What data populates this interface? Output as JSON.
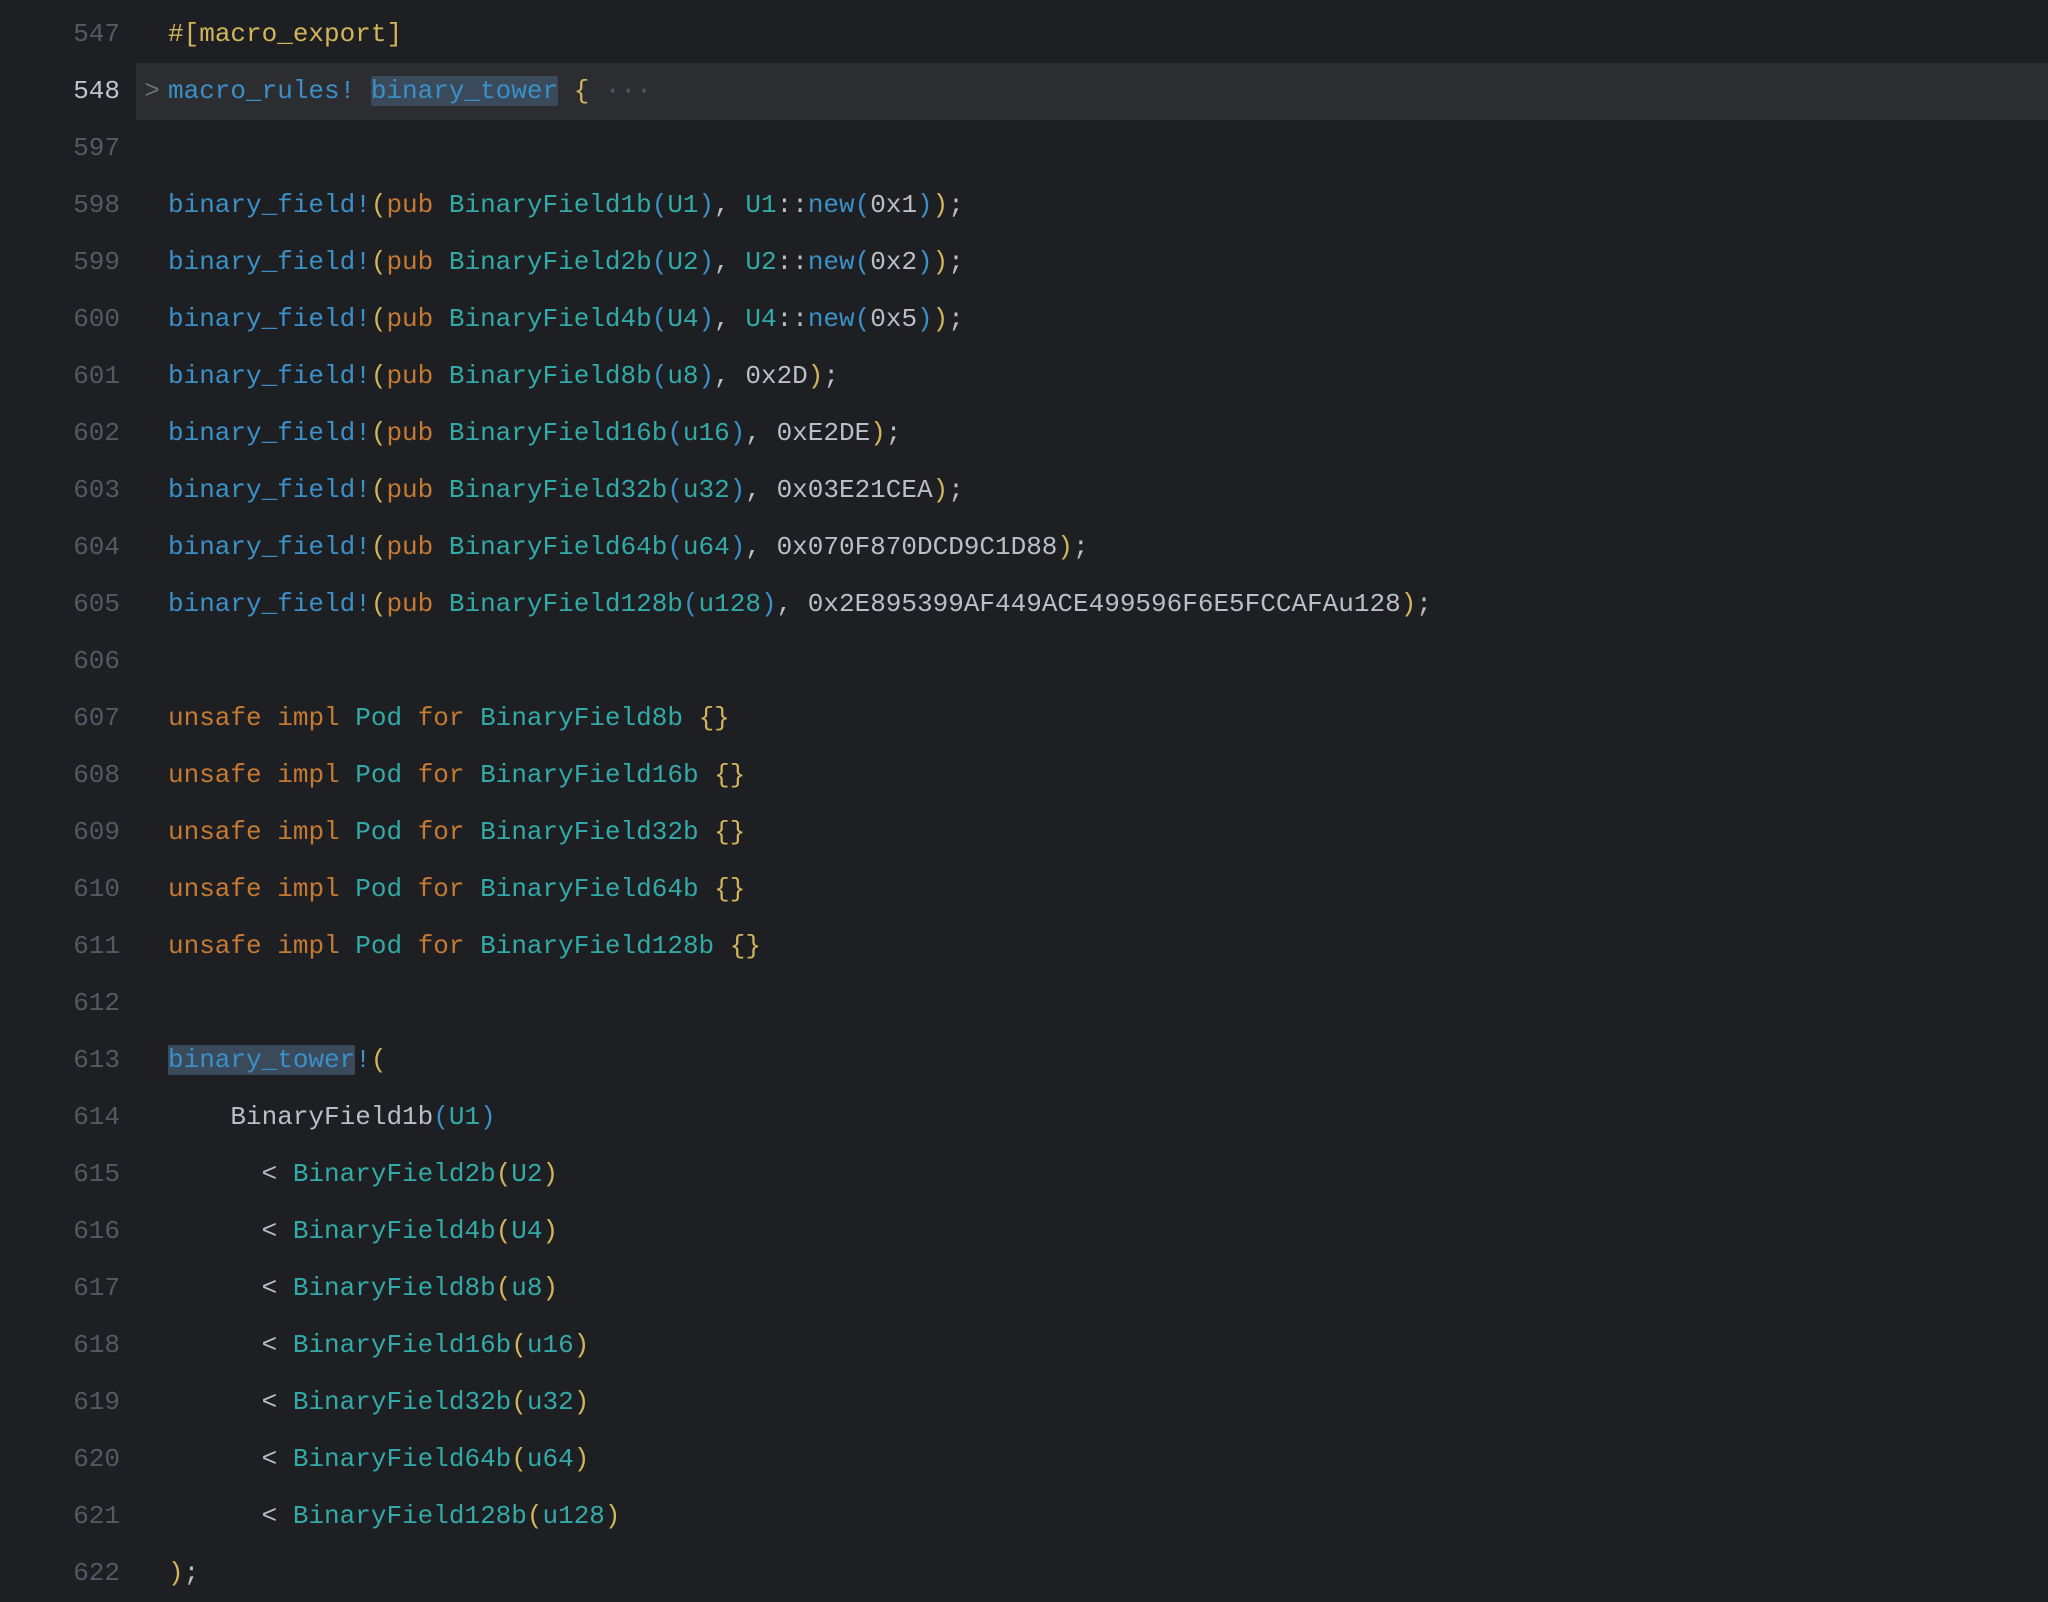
{
  "lines": [
    {
      "num": "547",
      "fold": " ",
      "current": false,
      "tokens": [
        {
          "t": "#[",
          "c": "c-attr"
        },
        {
          "t": "macro_export",
          "c": "c-attr"
        },
        {
          "t": "]",
          "c": "c-attr"
        }
      ]
    },
    {
      "num": "548",
      "fold": ">",
      "current": true,
      "tokens": [
        {
          "t": "macro_rules!",
          "c": "c-macrodef"
        },
        {
          "t": " ",
          "c": "c-plain"
        },
        {
          "t": "binary_tower",
          "c": "c-macrodef",
          "sel": true
        },
        {
          "t": " ",
          "c": "c-plain"
        },
        {
          "t": "{",
          "c": "c-brace"
        },
        {
          "t": " ···",
          "c": "c-faint"
        }
      ]
    },
    {
      "num": "597",
      "fold": " ",
      "current": false,
      "tokens": []
    },
    {
      "num": "598",
      "fold": " ",
      "current": false,
      "tokens": [
        {
          "t": "binary_field!",
          "c": "c-macro"
        },
        {
          "t": "(",
          "c": "c-paren1"
        },
        {
          "t": "pub",
          "c": "c-kw"
        },
        {
          "t": " ",
          "c": "c-plain"
        },
        {
          "t": "BinaryField1b",
          "c": "c-type"
        },
        {
          "t": "(",
          "c": "c-paren2"
        },
        {
          "t": "U1",
          "c": "c-type"
        },
        {
          "t": ")",
          "c": "c-paren2"
        },
        {
          "t": ", ",
          "c": "c-punct"
        },
        {
          "t": "U1",
          "c": "c-type"
        },
        {
          "t": "::",
          "c": "c-punct"
        },
        {
          "t": "new",
          "c": "c-fn"
        },
        {
          "t": "(",
          "c": "c-paren2"
        },
        {
          "t": "0x1",
          "c": "c-num"
        },
        {
          "t": ")",
          "c": "c-paren2"
        },
        {
          "t": ")",
          "c": "c-paren1"
        },
        {
          "t": ";",
          "c": "c-punct"
        }
      ]
    },
    {
      "num": "599",
      "fold": " ",
      "current": false,
      "tokens": [
        {
          "t": "binary_field!",
          "c": "c-macro"
        },
        {
          "t": "(",
          "c": "c-paren1"
        },
        {
          "t": "pub",
          "c": "c-kw"
        },
        {
          "t": " ",
          "c": "c-plain"
        },
        {
          "t": "BinaryField2b",
          "c": "c-type"
        },
        {
          "t": "(",
          "c": "c-paren2"
        },
        {
          "t": "U2",
          "c": "c-type"
        },
        {
          "t": ")",
          "c": "c-paren2"
        },
        {
          "t": ", ",
          "c": "c-punct"
        },
        {
          "t": "U2",
          "c": "c-type"
        },
        {
          "t": "::",
          "c": "c-punct"
        },
        {
          "t": "new",
          "c": "c-fn"
        },
        {
          "t": "(",
          "c": "c-paren2"
        },
        {
          "t": "0x2",
          "c": "c-num"
        },
        {
          "t": ")",
          "c": "c-paren2"
        },
        {
          "t": ")",
          "c": "c-paren1"
        },
        {
          "t": ";",
          "c": "c-punct"
        }
      ]
    },
    {
      "num": "600",
      "fold": " ",
      "current": false,
      "tokens": [
        {
          "t": "binary_field!",
          "c": "c-macro"
        },
        {
          "t": "(",
          "c": "c-paren1"
        },
        {
          "t": "pub",
          "c": "c-kw"
        },
        {
          "t": " ",
          "c": "c-plain"
        },
        {
          "t": "BinaryField4b",
          "c": "c-type"
        },
        {
          "t": "(",
          "c": "c-paren2"
        },
        {
          "t": "U4",
          "c": "c-type"
        },
        {
          "t": ")",
          "c": "c-paren2"
        },
        {
          "t": ", ",
          "c": "c-punct"
        },
        {
          "t": "U4",
          "c": "c-type"
        },
        {
          "t": "::",
          "c": "c-punct"
        },
        {
          "t": "new",
          "c": "c-fn"
        },
        {
          "t": "(",
          "c": "c-paren2"
        },
        {
          "t": "0x5",
          "c": "c-num"
        },
        {
          "t": ")",
          "c": "c-paren2"
        },
        {
          "t": ")",
          "c": "c-paren1"
        },
        {
          "t": ";",
          "c": "c-punct"
        }
      ]
    },
    {
      "num": "601",
      "fold": " ",
      "current": false,
      "tokens": [
        {
          "t": "binary_field!",
          "c": "c-macro"
        },
        {
          "t": "(",
          "c": "c-paren1"
        },
        {
          "t": "pub",
          "c": "c-kw"
        },
        {
          "t": " ",
          "c": "c-plain"
        },
        {
          "t": "BinaryField8b",
          "c": "c-type"
        },
        {
          "t": "(",
          "c": "c-paren2"
        },
        {
          "t": "u8",
          "c": "c-type"
        },
        {
          "t": ")",
          "c": "c-paren2"
        },
        {
          "t": ", ",
          "c": "c-punct"
        },
        {
          "t": "0x2D",
          "c": "c-num"
        },
        {
          "t": ")",
          "c": "c-paren1"
        },
        {
          "t": ";",
          "c": "c-punct"
        }
      ]
    },
    {
      "num": "602",
      "fold": " ",
      "current": false,
      "tokens": [
        {
          "t": "binary_field!",
          "c": "c-macro"
        },
        {
          "t": "(",
          "c": "c-paren1"
        },
        {
          "t": "pub",
          "c": "c-kw"
        },
        {
          "t": " ",
          "c": "c-plain"
        },
        {
          "t": "BinaryField16b",
          "c": "c-type"
        },
        {
          "t": "(",
          "c": "c-paren2"
        },
        {
          "t": "u16",
          "c": "c-type"
        },
        {
          "t": ")",
          "c": "c-paren2"
        },
        {
          "t": ", ",
          "c": "c-punct"
        },
        {
          "t": "0xE2DE",
          "c": "c-num"
        },
        {
          "t": ")",
          "c": "c-paren1"
        },
        {
          "t": ";",
          "c": "c-punct"
        }
      ]
    },
    {
      "num": "603",
      "fold": " ",
      "current": false,
      "tokens": [
        {
          "t": "binary_field!",
          "c": "c-macro"
        },
        {
          "t": "(",
          "c": "c-paren1"
        },
        {
          "t": "pub",
          "c": "c-kw"
        },
        {
          "t": " ",
          "c": "c-plain"
        },
        {
          "t": "BinaryField32b",
          "c": "c-type"
        },
        {
          "t": "(",
          "c": "c-paren2"
        },
        {
          "t": "u32",
          "c": "c-type"
        },
        {
          "t": ")",
          "c": "c-paren2"
        },
        {
          "t": ", ",
          "c": "c-punct"
        },
        {
          "t": "0x03E21CEA",
          "c": "c-num"
        },
        {
          "t": ")",
          "c": "c-paren1"
        },
        {
          "t": ";",
          "c": "c-punct"
        }
      ]
    },
    {
      "num": "604",
      "fold": " ",
      "current": false,
      "tokens": [
        {
          "t": "binary_field!",
          "c": "c-macro"
        },
        {
          "t": "(",
          "c": "c-paren1"
        },
        {
          "t": "pub",
          "c": "c-kw"
        },
        {
          "t": " ",
          "c": "c-plain"
        },
        {
          "t": "BinaryField64b",
          "c": "c-type"
        },
        {
          "t": "(",
          "c": "c-paren2"
        },
        {
          "t": "u64",
          "c": "c-type"
        },
        {
          "t": ")",
          "c": "c-paren2"
        },
        {
          "t": ", ",
          "c": "c-punct"
        },
        {
          "t": "0x070F870DCD9C1D88",
          "c": "c-num"
        },
        {
          "t": ")",
          "c": "c-paren1"
        },
        {
          "t": ";",
          "c": "c-punct"
        }
      ]
    },
    {
      "num": "605",
      "fold": " ",
      "current": false,
      "tokens": [
        {
          "t": "binary_field!",
          "c": "c-macro"
        },
        {
          "t": "(",
          "c": "c-paren1"
        },
        {
          "t": "pub",
          "c": "c-kw"
        },
        {
          "t": " ",
          "c": "c-plain"
        },
        {
          "t": "BinaryField128b",
          "c": "c-type"
        },
        {
          "t": "(",
          "c": "c-paren2"
        },
        {
          "t": "u128",
          "c": "c-type"
        },
        {
          "t": ")",
          "c": "c-paren2"
        },
        {
          "t": ", ",
          "c": "c-punct"
        },
        {
          "t": "0x2E895399AF449ACE499596F6E5FCCAFAu128",
          "c": "c-num"
        },
        {
          "t": ")",
          "c": "c-paren1"
        },
        {
          "t": ";",
          "c": "c-punct"
        }
      ]
    },
    {
      "num": "606",
      "fold": " ",
      "current": false,
      "tokens": []
    },
    {
      "num": "607",
      "fold": " ",
      "current": false,
      "tokens": [
        {
          "t": "unsafe",
          "c": "c-kw"
        },
        {
          "t": " ",
          "c": "c-plain"
        },
        {
          "t": "impl",
          "c": "c-kw"
        },
        {
          "t": " ",
          "c": "c-plain"
        },
        {
          "t": "Pod",
          "c": "c-type"
        },
        {
          "t": " ",
          "c": "c-plain"
        },
        {
          "t": "for",
          "c": "c-kw"
        },
        {
          "t": " ",
          "c": "c-plain"
        },
        {
          "t": "BinaryField8b",
          "c": "c-type"
        },
        {
          "t": " ",
          "c": "c-plain"
        },
        {
          "t": "{}",
          "c": "c-brace"
        }
      ]
    },
    {
      "num": "608",
      "fold": " ",
      "current": false,
      "tokens": [
        {
          "t": "unsafe",
          "c": "c-kw"
        },
        {
          "t": " ",
          "c": "c-plain"
        },
        {
          "t": "impl",
          "c": "c-kw"
        },
        {
          "t": " ",
          "c": "c-plain"
        },
        {
          "t": "Pod",
          "c": "c-type"
        },
        {
          "t": " ",
          "c": "c-plain"
        },
        {
          "t": "for",
          "c": "c-kw"
        },
        {
          "t": " ",
          "c": "c-plain"
        },
        {
          "t": "BinaryField16b",
          "c": "c-type"
        },
        {
          "t": " ",
          "c": "c-plain"
        },
        {
          "t": "{}",
          "c": "c-brace"
        }
      ]
    },
    {
      "num": "609",
      "fold": " ",
      "current": false,
      "tokens": [
        {
          "t": "unsafe",
          "c": "c-kw"
        },
        {
          "t": " ",
          "c": "c-plain"
        },
        {
          "t": "impl",
          "c": "c-kw"
        },
        {
          "t": " ",
          "c": "c-plain"
        },
        {
          "t": "Pod",
          "c": "c-type"
        },
        {
          "t": " ",
          "c": "c-plain"
        },
        {
          "t": "for",
          "c": "c-kw"
        },
        {
          "t": " ",
          "c": "c-plain"
        },
        {
          "t": "BinaryField32b",
          "c": "c-type"
        },
        {
          "t": " ",
          "c": "c-plain"
        },
        {
          "t": "{}",
          "c": "c-brace"
        }
      ]
    },
    {
      "num": "610",
      "fold": " ",
      "current": false,
      "tokens": [
        {
          "t": "unsafe",
          "c": "c-kw"
        },
        {
          "t": " ",
          "c": "c-plain"
        },
        {
          "t": "impl",
          "c": "c-kw"
        },
        {
          "t": " ",
          "c": "c-plain"
        },
        {
          "t": "Pod",
          "c": "c-type"
        },
        {
          "t": " ",
          "c": "c-plain"
        },
        {
          "t": "for",
          "c": "c-kw"
        },
        {
          "t": " ",
          "c": "c-plain"
        },
        {
          "t": "BinaryField64b",
          "c": "c-type"
        },
        {
          "t": " ",
          "c": "c-plain"
        },
        {
          "t": "{}",
          "c": "c-brace"
        }
      ]
    },
    {
      "num": "611",
      "fold": " ",
      "current": false,
      "tokens": [
        {
          "t": "unsafe",
          "c": "c-kw"
        },
        {
          "t": " ",
          "c": "c-plain"
        },
        {
          "t": "impl",
          "c": "c-kw"
        },
        {
          "t": " ",
          "c": "c-plain"
        },
        {
          "t": "Pod",
          "c": "c-type"
        },
        {
          "t": " ",
          "c": "c-plain"
        },
        {
          "t": "for",
          "c": "c-kw"
        },
        {
          "t": " ",
          "c": "c-plain"
        },
        {
          "t": "BinaryField128b",
          "c": "c-type"
        },
        {
          "t": " ",
          "c": "c-plain"
        },
        {
          "t": "{}",
          "c": "c-brace"
        }
      ]
    },
    {
      "num": "612",
      "fold": " ",
      "current": false,
      "tokens": []
    },
    {
      "num": "613",
      "fold": " ",
      "current": false,
      "tokens": [
        {
          "t": "binary_tower",
          "c": "c-macro",
          "sel": true
        },
        {
          "t": "!",
          "c": "c-macro"
        },
        {
          "t": "(",
          "c": "c-paren1"
        }
      ]
    },
    {
      "num": "614",
      "fold": " ",
      "current": false,
      "indent": 1,
      "tokens": [
        {
          "t": "BinaryField1b",
          "c": "c-plain"
        },
        {
          "t": "(",
          "c": "c-paren2"
        },
        {
          "t": "U1",
          "c": "c-type"
        },
        {
          "t": ")",
          "c": "c-paren2"
        }
      ]
    },
    {
      "num": "615",
      "fold": " ",
      "current": false,
      "indent": 1,
      "tokens": [
        {
          "t": "  < ",
          "c": "c-op"
        },
        {
          "t": "BinaryField2b",
          "c": "c-type"
        },
        {
          "t": "(",
          "c": "c-paren1"
        },
        {
          "t": "U2",
          "c": "c-type"
        },
        {
          "t": ")",
          "c": "c-paren1"
        }
      ]
    },
    {
      "num": "616",
      "fold": " ",
      "current": false,
      "indent": 1,
      "tokens": [
        {
          "t": "  < ",
          "c": "c-op"
        },
        {
          "t": "BinaryField4b",
          "c": "c-type"
        },
        {
          "t": "(",
          "c": "c-paren1"
        },
        {
          "t": "U4",
          "c": "c-type"
        },
        {
          "t": ")",
          "c": "c-paren1"
        }
      ]
    },
    {
      "num": "617",
      "fold": " ",
      "current": false,
      "indent": 1,
      "tokens": [
        {
          "t": "  < ",
          "c": "c-op"
        },
        {
          "t": "BinaryField8b",
          "c": "c-type"
        },
        {
          "t": "(",
          "c": "c-paren1"
        },
        {
          "t": "u8",
          "c": "c-type"
        },
        {
          "t": ")",
          "c": "c-paren1"
        }
      ]
    },
    {
      "num": "618",
      "fold": " ",
      "current": false,
      "indent": 1,
      "tokens": [
        {
          "t": "  < ",
          "c": "c-op"
        },
        {
          "t": "BinaryField16b",
          "c": "c-type"
        },
        {
          "t": "(",
          "c": "c-paren1"
        },
        {
          "t": "u16",
          "c": "c-type"
        },
        {
          "t": ")",
          "c": "c-paren1"
        }
      ]
    },
    {
      "num": "619",
      "fold": " ",
      "current": false,
      "indent": 1,
      "tokens": [
        {
          "t": "  < ",
          "c": "c-op"
        },
        {
          "t": "BinaryField32b",
          "c": "c-type"
        },
        {
          "t": "(",
          "c": "c-paren1"
        },
        {
          "t": "u32",
          "c": "c-type"
        },
        {
          "t": ")",
          "c": "c-paren1"
        }
      ]
    },
    {
      "num": "620",
      "fold": " ",
      "current": false,
      "indent": 1,
      "tokens": [
        {
          "t": "  < ",
          "c": "c-op"
        },
        {
          "t": "BinaryField64b",
          "c": "c-type"
        },
        {
          "t": "(",
          "c": "c-paren1"
        },
        {
          "t": "u64",
          "c": "c-type"
        },
        {
          "t": ")",
          "c": "c-paren1"
        }
      ]
    },
    {
      "num": "621",
      "fold": " ",
      "current": false,
      "indent": 1,
      "tokens": [
        {
          "t": "  < ",
          "c": "c-op"
        },
        {
          "t": "BinaryField128b",
          "c": "c-type"
        },
        {
          "t": "(",
          "c": "c-paren1"
        },
        {
          "t": "u128",
          "c": "c-type"
        },
        {
          "t": ")",
          "c": "c-paren1"
        }
      ]
    },
    {
      "num": "622",
      "fold": " ",
      "current": false,
      "tokens": [
        {
          "t": ")",
          "c": "c-paren1"
        },
        {
          "t": ";",
          "c": "c-punct"
        }
      ]
    }
  ]
}
